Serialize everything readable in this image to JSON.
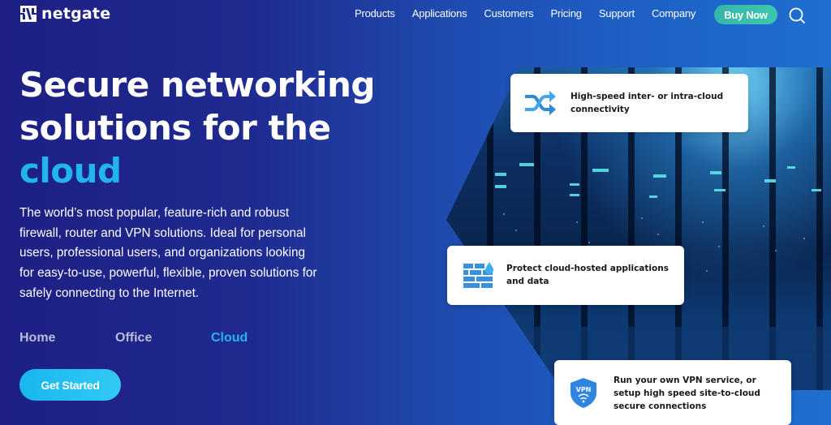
{
  "brand": {
    "name": "netgate",
    "logo_icon": "netgate-logo-icon"
  },
  "nav": {
    "links": [
      "Products",
      "Applications",
      "Customers",
      "Pricing",
      "Support",
      "Company"
    ],
    "buy_label": "Buy Now",
    "search_icon": "search-icon"
  },
  "hero": {
    "title_line1": "Secure networking",
    "title_line2": "solutions for the",
    "title_accent": "cloud",
    "description": "The world’s most popular, feature-rich and robust firewall, router and VPN solutions. Ideal for personal users, professional users, and organizations looking for easy-to-use, powerful, flexible, proven solutions for safely connecting to the Internet.",
    "tabs": [
      {
        "label": "Home",
        "active": false
      },
      {
        "label": "Office",
        "active": false
      },
      {
        "label": "Cloud",
        "active": true
      }
    ],
    "cta_label": "Get Started"
  },
  "features": [
    {
      "icon": "shuffle-arrows-icon",
      "text": "High-speed inter- or intra-cloud connectivity"
    },
    {
      "icon": "firewall-brick-icon",
      "text": "Protect cloud-hosted applications and data"
    },
    {
      "icon": "vpn-shield-icon",
      "text": "Run your own VPN service, or setup high speed site-to-cloud secure connections",
      "shield_label": "VPN"
    }
  ],
  "colors": {
    "accent": "#21b4ee",
    "buy_button": "#3ec6ad",
    "cta": "#18b6ef",
    "icon_blue": "#2e7fd6"
  }
}
